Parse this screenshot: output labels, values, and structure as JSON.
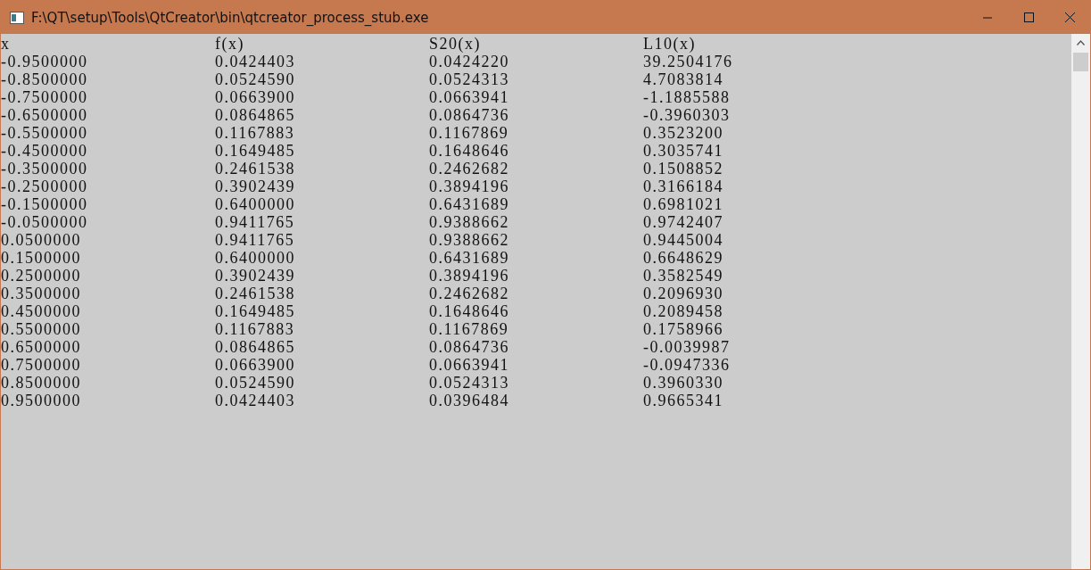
{
  "window": {
    "title": "F:\\QT\\setup\\Tools\\QtCreator\\bin\\qtcreator_process_stub.exe"
  },
  "console": {
    "header": [
      "x",
      "f(x)",
      "S20(x)",
      "L10(x)"
    ],
    "rows": [
      [
        "-0.9500000",
        "0.0424403",
        "0.0424220",
        "39.2504176"
      ],
      [
        "-0.8500000",
        "0.0524590",
        "0.0524313",
        "4.7083814"
      ],
      [
        "-0.7500000",
        "0.0663900",
        "0.0663941",
        "-1.1885588"
      ],
      [
        "-0.6500000",
        "0.0864865",
        "0.0864736",
        "-0.3960303"
      ],
      [
        "-0.5500000",
        "0.1167883",
        "0.1167869",
        "0.3523200"
      ],
      [
        "-0.4500000",
        "0.1649485",
        "0.1648646",
        "0.3035741"
      ],
      [
        "-0.3500000",
        "0.2461538",
        "0.2462682",
        "0.1508852"
      ],
      [
        "-0.2500000",
        "0.3902439",
        "0.3894196",
        "0.3166184"
      ],
      [
        "-0.1500000",
        "0.6400000",
        "0.6431689",
        "0.6981021"
      ],
      [
        "-0.0500000",
        "0.9411765",
        "0.9388662",
        "0.9742407"
      ],
      [
        "0.0500000",
        "0.9411765",
        "0.9388662",
        "0.9445004"
      ],
      [
        "0.1500000",
        "0.6400000",
        "0.6431689",
        "0.6648629"
      ],
      [
        "0.2500000",
        "0.3902439",
        "0.3894196",
        "0.3582549"
      ],
      [
        "0.3500000",
        "0.2461538",
        "0.2462682",
        "0.2096930"
      ],
      [
        "0.4500000",
        "0.1649485",
        "0.1648646",
        "0.2089458"
      ],
      [
        "0.5500000",
        "0.1167883",
        "0.1167869",
        "0.1758966"
      ],
      [
        "0.6500000",
        "0.0864865",
        "0.0864736",
        "-0.0039987"
      ],
      [
        "0.7500000",
        "0.0663900",
        "0.0663941",
        "-0.0947336"
      ],
      [
        "0.8500000",
        "0.0524590",
        "0.0524313",
        "0.3960330"
      ],
      [
        "0.9500000",
        "0.0424403",
        "0.0396484",
        "0.9665341"
      ]
    ]
  }
}
